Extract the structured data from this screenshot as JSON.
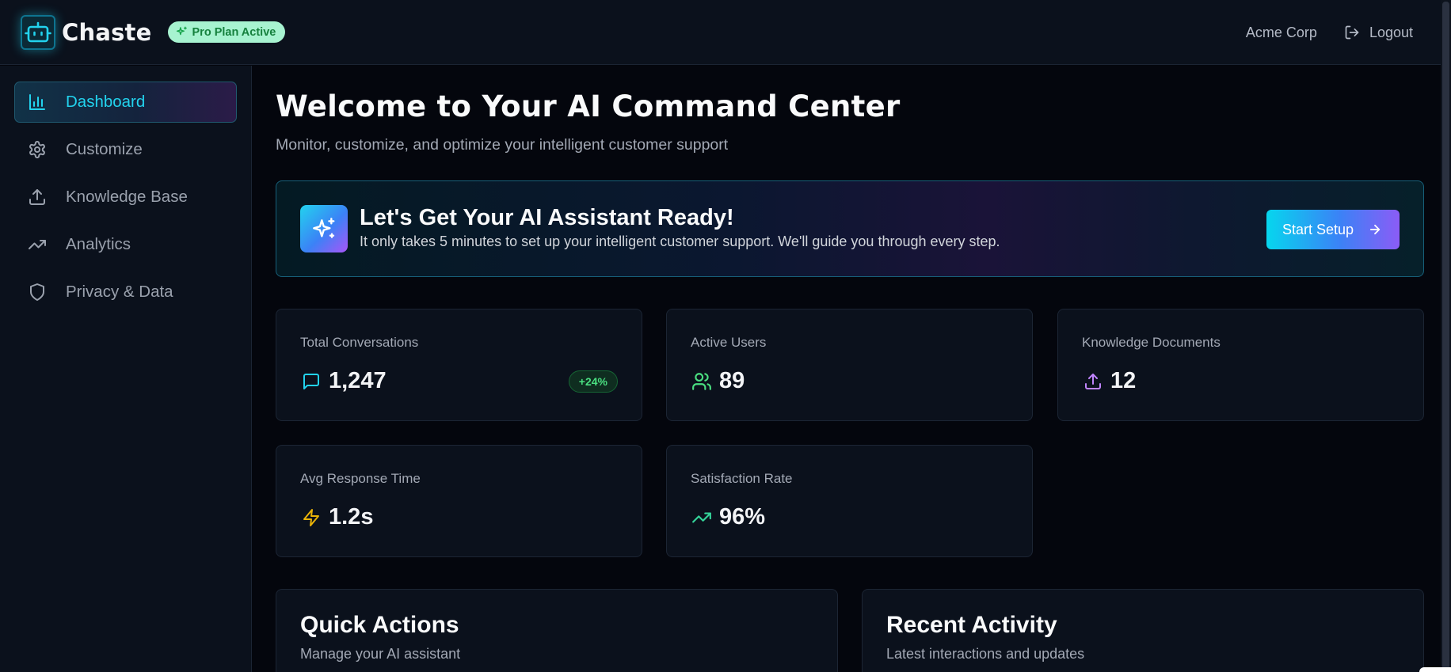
{
  "app": {
    "name": "Chaste",
    "plan_badge": "Pro Plan Active",
    "org_name": "Acme Corp",
    "logout_label": "Logout"
  },
  "sidebar": {
    "items": [
      {
        "label": "Dashboard",
        "icon": "bar-chart-icon",
        "active": true
      },
      {
        "label": "Customize",
        "icon": "gear-icon",
        "active": false
      },
      {
        "label": "Knowledge Base",
        "icon": "upload-icon",
        "active": false
      },
      {
        "label": "Analytics",
        "icon": "trending-up-icon",
        "active": false
      },
      {
        "label": "Privacy & Data",
        "icon": "shield-icon",
        "active": false
      }
    ]
  },
  "main": {
    "title": "Welcome to Your AI Command Center",
    "subtitle": "Monitor, customize, and optimize your intelligent customer support"
  },
  "banner": {
    "title": "Let's Get Your AI Assistant Ready!",
    "text": "It only takes 5 minutes to set up your intelligent customer support. We'll guide you through every step.",
    "button_label": "Start Setup",
    "icon": "sparkles-icon"
  },
  "stats": [
    {
      "label": "Total Conversations",
      "value": "1,247",
      "delta": "+24%",
      "icon": "message-square-icon",
      "color": "#22d3ee"
    },
    {
      "label": "Active Users",
      "value": "89",
      "icon": "users-icon",
      "color": "#4ade80"
    },
    {
      "label": "Knowledge Documents",
      "value": "12",
      "icon": "upload-icon",
      "color": "#c084fc"
    },
    {
      "label": "Avg Response Time",
      "value": "1.2s",
      "icon": "zap-icon",
      "color": "#eab308"
    },
    {
      "label": "Satisfaction Rate",
      "value": "96%",
      "icon": "trending-up-icon",
      "color": "#34d399"
    }
  ],
  "panels": {
    "quick_actions": {
      "title": "Quick Actions",
      "subtitle": "Manage your AI assistant"
    },
    "recent_activity": {
      "title": "Recent Activity",
      "subtitle": "Latest interactions and updates"
    }
  },
  "colors": {
    "accent_cyan": "#22d3ee",
    "accent_purple": "#8b5cf6",
    "success_green": "#4ade80",
    "background": "#04060d",
    "surface": "#0b111c"
  }
}
